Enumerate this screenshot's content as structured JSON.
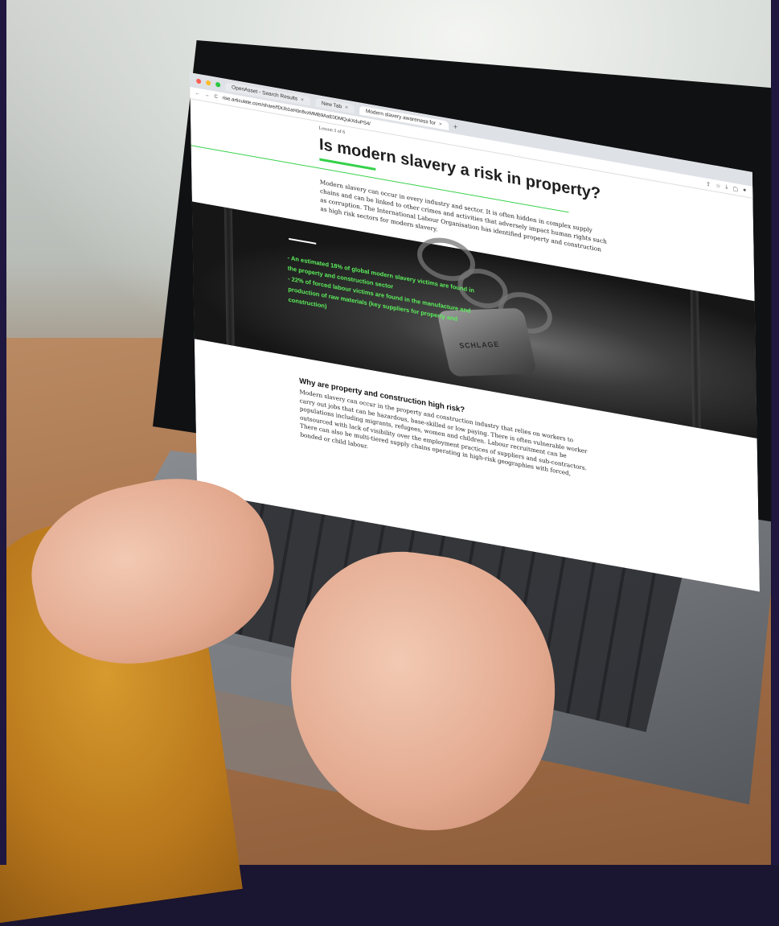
{
  "browser": {
    "tabs": [
      {
        "label": "OpenAsset - Search Results",
        "close": "×"
      },
      {
        "label": "New Tab",
        "close": "×"
      },
      {
        "label": "Modern slavery awareness for",
        "close": "×"
      }
    ],
    "new_tab": "+",
    "address": "rise.articulate.com/share/fDtJb1aH0n8vzMMB9AaE0DMQukXduPS4/",
    "nav": {
      "back": "←",
      "forward": "→",
      "reload": "C"
    },
    "toolbar_icons": [
      "share-icon",
      "star-icon",
      "download-icon",
      "sidepanel-icon",
      "profile-icon"
    ]
  },
  "page": {
    "lesson": "Lesson 3 of 6",
    "title": "Is modern slavery a risk in property?",
    "intro": "Modern slavery can occur in every industry and sector.  It is often hidden in complex supply chains and can be linked to other crimes and activities that adversely impact human rights such as corruption.  The International Labour Organisation has identified property and construction as high risk sectors for modern slavery.",
    "banner": {
      "lock_brand": "SCHLAGE",
      "line1": "- An estimated 18% of global modern slavery victims are found in the property and construction sector",
      "line2": "- 22% of forced labour victims are found in the manufacture and production of raw materials (key suppliers for property and construction)"
    },
    "section": {
      "heading": "Why are property and construction high risk?",
      "body": "Modern slavery can occur in the property and construction industry that relies on workers to carry out jobs that can be hazardous, base-skilled or low paying. There is often vulnerable worker populations including migrants, refugees, women and children. Labour recruitment can be outsourced with lack of visibility over the employment practices of suppliers and sub-contractors. There can also be multi-tiered supply chains operating in high-risk geographies with forced, bonded or child labour."
    },
    "colors": {
      "accent": "#35d14a",
      "banner_text": "#5cf05c",
      "border": "#1f1740"
    }
  }
}
